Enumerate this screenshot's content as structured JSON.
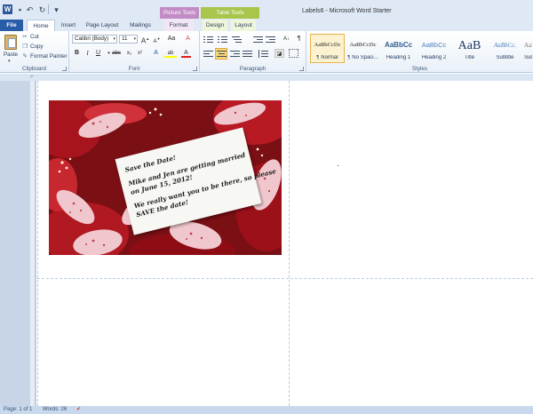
{
  "app": {
    "window_title": "Labels6 - Microsoft Word Starter",
    "contextual_tabs": {
      "picture_tools": "Picture Tools",
      "table_tools": "Table Tools"
    }
  },
  "tabs": [
    "File",
    "Home",
    "Insert",
    "Page Layout",
    "Mailings",
    "Format",
    "Design",
    "Layout"
  ],
  "ribbon": {
    "clipboard": {
      "group_label": "Clipboard",
      "paste": "Paste",
      "cut": "Cut",
      "copy": "Copy",
      "format_painter": "Format Painter"
    },
    "font": {
      "group_label": "Font",
      "font_name": "Calibri (Body)",
      "font_size": "11",
      "grow": "A",
      "shrink": "A",
      "change_case": "Aa",
      "clear": "A",
      "bold": "B",
      "italic": "I",
      "underline": "U",
      "strike": "abc",
      "subscript": "x₂",
      "superscript": "x²",
      "text_effects": "A",
      "highlight": "ab",
      "font_color": "A"
    },
    "paragraph": {
      "group_label": "Paragraph",
      "sort": "A↓",
      "show_marks": "¶"
    },
    "styles": {
      "group_label": "Styles",
      "items": [
        {
          "preview": "AaBbCcDc",
          "name": "¶ Normal"
        },
        {
          "preview": "AaBbCcDc",
          "name": "¶ No Spaci..."
        },
        {
          "preview": "AaBbCc",
          "name": "Heading 1"
        },
        {
          "preview": "AaBbCc",
          "name": "Heading 2"
        },
        {
          "preview": "AaB",
          "name": "Title"
        },
        {
          "preview": "AaBbCc.",
          "name": "Subtitle"
        },
        {
          "preview": "AaBbCc",
          "name": "Subtl"
        }
      ]
    }
  },
  "document": {
    "card_lines": [
      "Save the Date!",
      "Mike and Jen are getting married",
      "on June 15, 2012!",
      "We really want you to be there, so please",
      "SAVE the date!"
    ]
  },
  "statusbar": {
    "page": "Page: 1 of 1",
    "words": "Words: 26"
  },
  "colors": {
    "file_tab": "#2a5da8",
    "picture_tools": "#c38bc6",
    "table_tools": "#a8c64c",
    "selected_style": "#fdf2cf"
  }
}
